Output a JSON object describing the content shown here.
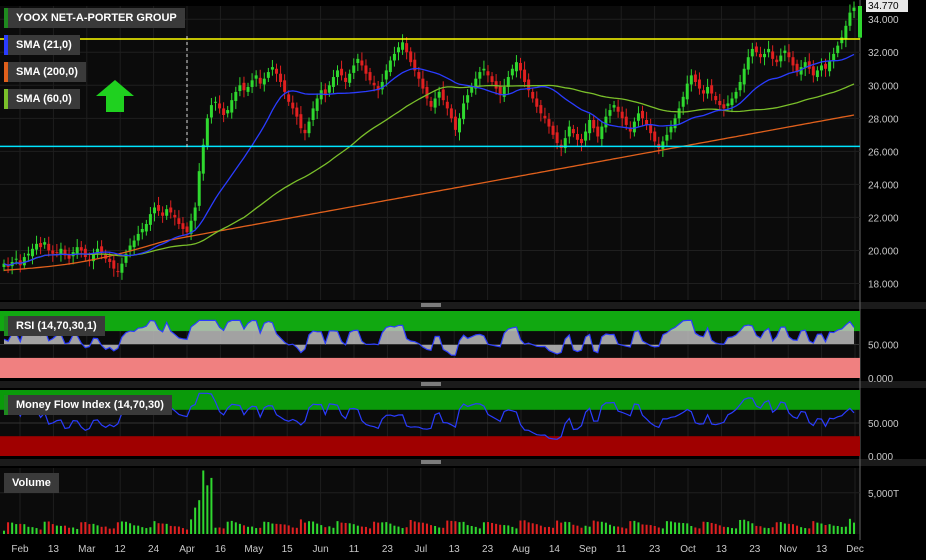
{
  "chart_data": {
    "type": "candlestick",
    "title": "YOOX NET-A-PORTER GROUP",
    "last_price": "34.770",
    "price_axis": {
      "ylim": [
        17.0,
        34.8
      ],
      "tick_labels": [
        "18.000",
        "20.000",
        "22.000",
        "24.000",
        "26.000",
        "28.000",
        "30.000",
        "32.000",
        "34.000"
      ],
      "ticks": [
        18,
        20,
        22,
        24,
        26,
        28,
        30,
        32,
        34
      ]
    },
    "x_tick_labels": [
      "Feb",
      "13",
      "Mar",
      "12",
      "24",
      "Apr",
      "16",
      "May",
      "15",
      "Jun",
      "11",
      "23",
      "Jul",
      "13",
      "23",
      "Aug",
      "14",
      "Sep",
      "11",
      "23",
      "Oct",
      "13",
      "23",
      "Nov",
      "13",
      "Dec"
    ],
    "indicators": [
      {
        "name": "SMA (21,0)",
        "color": "#2a3cff"
      },
      {
        "name": "SMA (200,0)",
        "color": "#e0601c"
      },
      {
        "name": "SMA (60,0)",
        "color": "#7abf2a"
      }
    ],
    "horizontal_lines": [
      {
        "value": 32.8,
        "color": "#ffff00"
      },
      {
        "value": 26.3,
        "color": "#00e5ff"
      }
    ],
    "close_prices": [
      19.2,
      19.0,
      19.3,
      19.5,
      19.1,
      19.6,
      19.8,
      20.1,
      20.4,
      20.2,
      20.5,
      20.0,
      19.8,
      19.9,
      20.1,
      19.7,
      19.5,
      19.9,
      20.2,
      20.0,
      19.6,
      19.4,
      19.8,
      20.1,
      19.9,
      19.5,
      19.3,
      18.9,
      18.7,
      19.2,
      19.8,
      20.3,
      20.6,
      21.0,
      21.3,
      21.6,
      22.2,
      22.6,
      22.4,
      22.1,
      22.5,
      22.3,
      22.0,
      21.6,
      21.3,
      21.1,
      21.8,
      22.6,
      24.8,
      26.4,
      28.0,
      28.8,
      29.0,
      28.6,
      28.2,
      28.5,
      29.1,
      29.6,
      30.0,
      29.7,
      29.9,
      30.3,
      30.6,
      30.1,
      30.4,
      30.8,
      31.1,
      30.7,
      30.2,
      29.6,
      29.0,
      28.6,
      28.1,
      27.4,
      27.1,
      27.8,
      28.6,
      29.2,
      29.7,
      29.4,
      30.0,
      30.5,
      30.9,
      30.6,
      30.2,
      30.7,
      31.2,
      31.6,
      31.2,
      30.7,
      30.3,
      30.0,
      29.7,
      30.2,
      30.9,
      31.5,
      31.9,
      32.3,
      32.6,
      32.0,
      31.4,
      30.9,
      30.4,
      29.8,
      29.2,
      28.7,
      29.2,
      29.6,
      29.1,
      28.6,
      28.0,
      27.3,
      28.0,
      28.9,
      29.4,
      29.9,
      30.4,
      30.8,
      31.0,
      30.6,
      30.2,
      29.8,
      29.4,
      29.9,
      30.5,
      31.0,
      31.4,
      30.9,
      30.2,
      29.7,
      29.2,
      28.7,
      28.3,
      28.0,
      27.5,
      27.0,
      26.5,
      26.2,
      26.8,
      27.5,
      27.1,
      26.7,
      26.5,
      27.2,
      27.9,
      27.4,
      26.9,
      27.5,
      28.1,
      28.5,
      28.8,
      28.4,
      28.0,
      27.6,
      27.2,
      27.8,
      28.3,
      28.0,
      27.6,
      27.1,
      26.6,
      26.2,
      26.6,
      27.0,
      27.5,
      28.0,
      28.6,
      29.3,
      30.1,
      30.6,
      30.2,
      29.8,
      29.5,
      29.9,
      29.5,
      29.1,
      28.8,
      28.6,
      28.9,
      29.2,
      29.6,
      30.2,
      31.0,
      31.7,
      32.2,
      32.0,
      31.7,
      31.9,
      32.2,
      31.6,
      31.4,
      31.8,
      32.1,
      31.7,
      31.2,
      30.8,
      31.1,
      31.4,
      31.0,
      30.6,
      30.9,
      31.2,
      31.0,
      31.5,
      31.9,
      32.4,
      32.9,
      33.6,
      34.4,
      34.7
    ],
    "rsi": {
      "label": "RSI (14,70,30,1)",
      "upper": 70,
      "lower": 30,
      "ylim": [
        0,
        100
      ],
      "tick_labels": [
        "0.000",
        "50.000"
      ],
      "ticks": [
        0,
        50
      ]
    },
    "mfi": {
      "label": "Money Flow Index (14,70,30)",
      "upper": 70,
      "lower": 30,
      "ylim": [
        0,
        100
      ],
      "tick_labels": [
        "0.000",
        "50.000"
      ],
      "ticks": [
        0,
        50
      ]
    },
    "volume": {
      "label": "Volume",
      "tick_labels": [
        "5,000T"
      ],
      "ticks": [
        5000
      ]
    }
  }
}
